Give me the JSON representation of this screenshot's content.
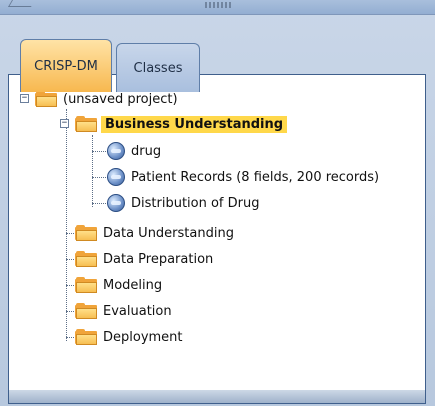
{
  "tabs": [
    {
      "label": "CRISP-DM"
    },
    {
      "label": "Classes"
    }
  ],
  "tree": {
    "root": {
      "label": "(unsaved project)"
    },
    "business_understanding": {
      "label": "Business Understanding"
    },
    "business_children": [
      {
        "label": "drug"
      },
      {
        "label": "Patient Records (8 fields, 200 records)"
      },
      {
        "label": "Distribution of Drug"
      }
    ],
    "phases": [
      {
        "label": "Data Understanding"
      },
      {
        "label": "Data Preparation"
      },
      {
        "label": "Modeling"
      },
      {
        "label": "Evaluation"
      },
      {
        "label": "Deployment"
      }
    ]
  }
}
